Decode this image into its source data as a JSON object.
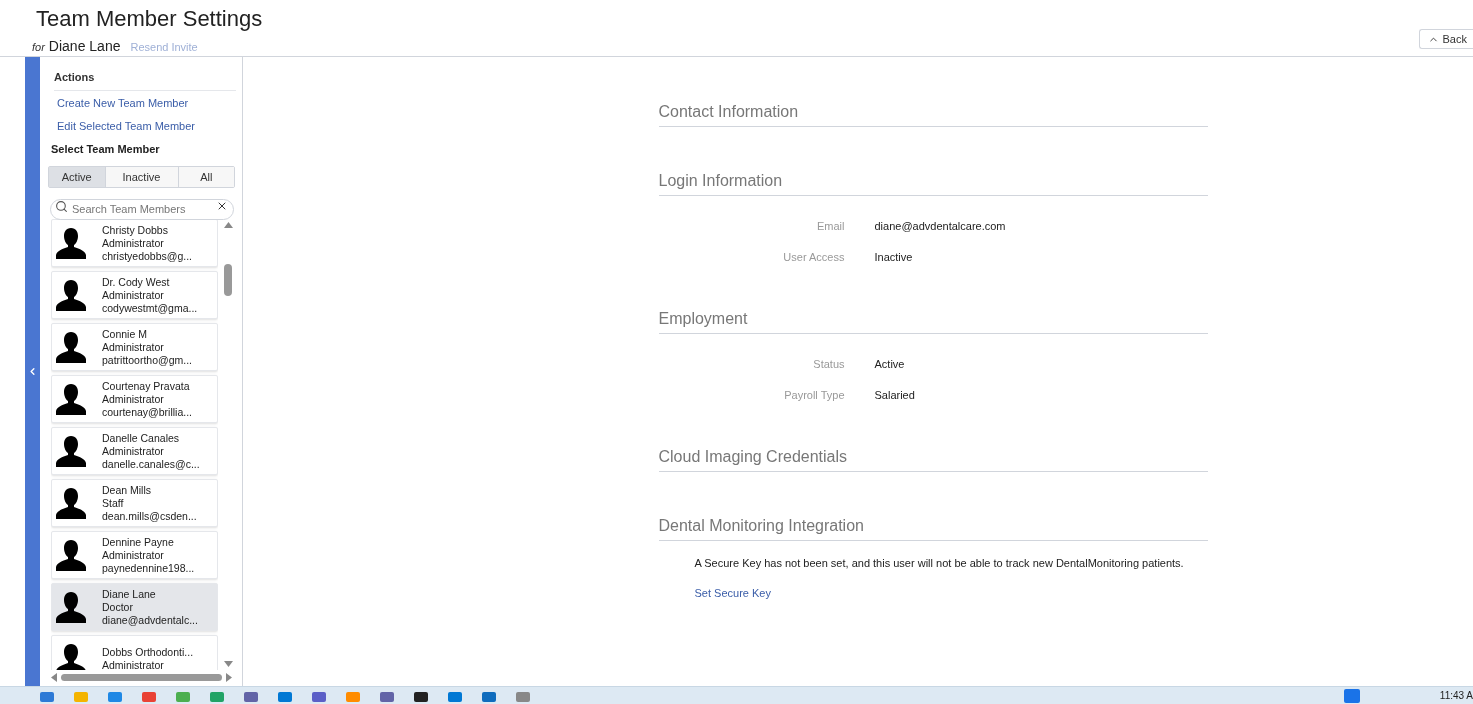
{
  "header": {
    "title": "Team Member Settings",
    "for_label": "for",
    "member_name": "Diane Lane",
    "resend_link": "Resend Invite",
    "back_button": "Back"
  },
  "sidebar": {
    "actions_title": "Actions",
    "actions": [
      "Create New Team Member",
      "Edit Selected Team Member"
    ],
    "select_title": "Select Team Member",
    "filters": [
      {
        "label": "Active",
        "selected": true
      },
      {
        "label": "Inactive",
        "selected": false
      },
      {
        "label": "All",
        "selected": false
      }
    ],
    "search": {
      "placeholder": "Search Team Members"
    },
    "members": [
      {
        "name": "Christy Dobbs",
        "role": "Administrator",
        "email": "christyedobbs@g...",
        "selected": false
      },
      {
        "name": "Dr. Cody West",
        "role": "Administrator",
        "email": "codywestmt@gma...",
        "selected": false
      },
      {
        "name": "Connie M",
        "role": "Administrator",
        "email": "patrittoortho@gm...",
        "selected": false
      },
      {
        "name": "Courtenay Pravata",
        "role": "Administrator",
        "email": "courtenay@brillia...",
        "selected": false
      },
      {
        "name": "Danelle Canales",
        "role": "Administrator",
        "email": "danelle.canales@c...",
        "selected": false
      },
      {
        "name": "Dean Mills",
        "role": "Staff",
        "email": "dean.mills@csden...",
        "selected": false
      },
      {
        "name": "Dennine Payne",
        "role": "Administrator",
        "email": "paynedennine198...",
        "selected": false
      },
      {
        "name": "Diane Lane",
        "role": "Doctor",
        "email": "diane@advdentalc...",
        "selected": true
      },
      {
        "name": "Dobbs Orthodonti...",
        "role": "Administrator",
        "selected": false
      }
    ]
  },
  "sections": [
    {
      "title": "Contact Information"
    },
    {
      "title": "Login Information",
      "fields": [
        {
          "label": "Email",
          "value": "diane@advdentalcare.com"
        },
        {
          "label": "User Access",
          "value": "Inactive"
        }
      ]
    },
    {
      "title": "Employment",
      "fields": [
        {
          "label": "Status",
          "value": "Active"
        },
        {
          "label": "Payroll Type",
          "value": "Salaried"
        }
      ]
    },
    {
      "title": "Cloud Imaging Credentials"
    },
    {
      "title": "Dental Monitoring Integration",
      "note": "A Secure Key has not been set, and this user will not be able to track new DentalMonitoring patients.",
      "link": "Set Secure Key"
    }
  ],
  "taskbar": {
    "time": "11:43 A"
  }
}
